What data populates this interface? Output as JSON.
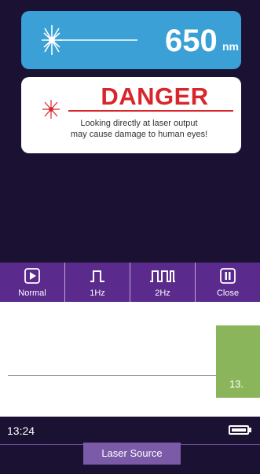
{
  "wavelength": {
    "value": "650",
    "unit": "nm"
  },
  "danger": {
    "title": "DANGER",
    "message_line1": "Looking directly at laser output",
    "message_line2": "may cause damage to human eyes!"
  },
  "toolbar": {
    "normal_label": "Normal",
    "hz1_label": "1Hz",
    "hz2_label": "2Hz",
    "close_label": "Close"
  },
  "page_number": "13.",
  "status": {
    "time": "13:24"
  },
  "page_title": "Laser Source",
  "colors": {
    "screen_bg": "#1b1233",
    "wave_card": "#3aa0d6",
    "danger_red": "#d8262c",
    "toolbar": "#5a2a8c",
    "title_tab": "#7b5aa8",
    "green_box": "#8bb55a"
  },
  "icons": [
    "laser-burst-icon",
    "play-icon",
    "single-pulse-icon",
    "double-pulse-icon",
    "pause-icon",
    "battery-icon"
  ]
}
